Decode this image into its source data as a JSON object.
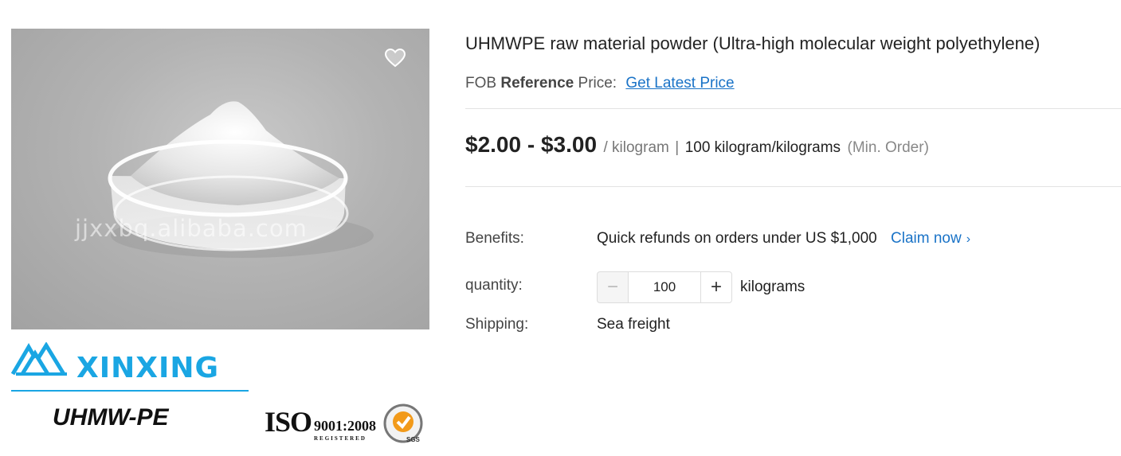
{
  "gallery": {
    "watermark": "jjxxbq.alibaba.com",
    "favorite_icon": "heart-outline-icon",
    "brand": {
      "name": "XINXING",
      "product": "UHMW-PE",
      "iso_mark": "ISO",
      "iso_number": "9001:2008",
      "iso_registered": "REGISTERED",
      "sgs_label": "SGS",
      "accent_color": "#1aa6e3"
    }
  },
  "product": {
    "title": "UHMWPE raw material powder (Ultra-high molecular weight polyethylene)",
    "reference": {
      "prefix": "FOB",
      "bold": "Reference",
      "suffix": "Price:",
      "link": "Get Latest Price"
    },
    "price": {
      "range": "$2.00 - $3.00",
      "unit": "/ kilogram",
      "separator": "|",
      "moq": "100 kilogram/kilograms",
      "moq_note": "(Min. Order)"
    },
    "benefits": {
      "label": "Benefits:",
      "text": "Quick refunds on orders under US $1,000",
      "link": "Claim now"
    },
    "quantity": {
      "label": "quantity:",
      "minus": "−",
      "value": "100",
      "plus": "+",
      "unit": "kilograms"
    },
    "shipping": {
      "label": "Shipping:",
      "value": "Sea freight"
    }
  },
  "colors": {
    "link": "#1a73c7",
    "text": "#222222",
    "muted": "#777777"
  }
}
